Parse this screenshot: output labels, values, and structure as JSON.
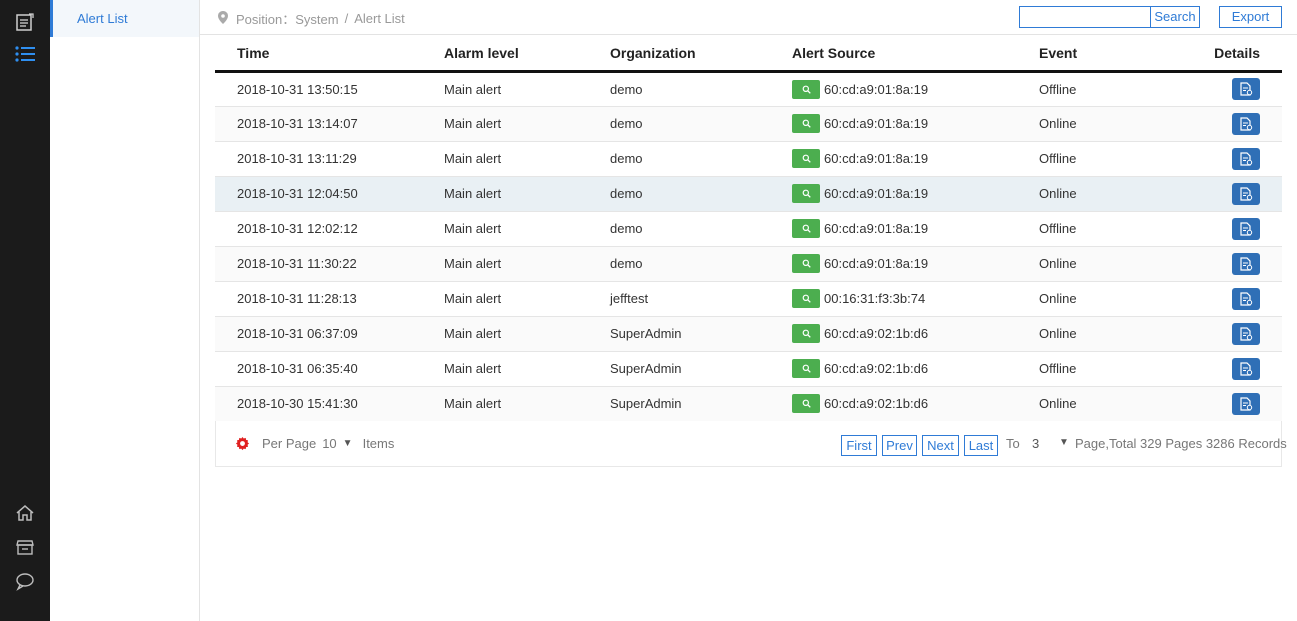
{
  "rail": {
    "icons": [
      "notebook-icon",
      "list-icon",
      "home-icon",
      "store-icon",
      "chat-icon"
    ]
  },
  "subnav": {
    "active_item": "Alert List"
  },
  "breadcrumb": {
    "prefix": "Position：System",
    "separator": "/",
    "current": "Alert List"
  },
  "search": {
    "value": "",
    "placeholder": "",
    "button_label": "Search"
  },
  "export_label": "Export",
  "colors": {
    "accent": "#2f7bd6",
    "rail_bg": "#1b1b1b",
    "query_green": "#4cae4f",
    "details_blue": "#2f6fb6"
  },
  "table": {
    "headers": {
      "time": "Time",
      "level": "Alarm level",
      "org": "Organization",
      "source": "Alert Source",
      "event": "Event",
      "details": "Details"
    },
    "rows": [
      {
        "time": "2018-10-31 13:50:15",
        "level": "Main alert",
        "org": "demo",
        "source": "60:cd:a9:01:8a:19",
        "event": "Offline"
      },
      {
        "time": "2018-10-31 13:14:07",
        "level": "Main alert",
        "org": "demo",
        "source": "60:cd:a9:01:8a:19",
        "event": "Online"
      },
      {
        "time": "2018-10-31 13:11:29",
        "level": "Main alert",
        "org": "demo",
        "source": "60:cd:a9:01:8a:19",
        "event": "Offline"
      },
      {
        "time": "2018-10-31 12:04:50",
        "level": "Main alert",
        "org": "demo",
        "source": "60:cd:a9:01:8a:19",
        "event": "Online"
      },
      {
        "time": "2018-10-31 12:02:12",
        "level": "Main alert",
        "org": "demo",
        "source": "60:cd:a9:01:8a:19",
        "event": "Offline"
      },
      {
        "time": "2018-10-31 11:30:22",
        "level": "Main alert",
        "org": "demo",
        "source": "60:cd:a9:01:8a:19",
        "event": "Online"
      },
      {
        "time": "2018-10-31 11:28:13",
        "level": "Main alert",
        "org": "jefftest",
        "source": "00:16:31:f3:3b:74",
        "event": "Online"
      },
      {
        "time": "2018-10-31 06:37:09",
        "level": "Main alert",
        "org": "SuperAdmin",
        "source": "60:cd:a9:02:1b:d6",
        "event": "Online"
      },
      {
        "time": "2018-10-31 06:35:40",
        "level": "Main alert",
        "org": "SuperAdmin",
        "source": "60:cd:a9:02:1b:d6",
        "event": "Offline"
      },
      {
        "time": "2018-10-30 15:41:30",
        "level": "Main alert",
        "org": "SuperAdmin",
        "source": "60:cd:a9:02:1b:d6",
        "event": "Online"
      }
    ]
  },
  "pager": {
    "per_page_label": "Per Page",
    "per_page_value": "10",
    "items_label": "Items",
    "first": "First",
    "prev": "Prev",
    "next": "Next",
    "last": "Last",
    "to_label": "To",
    "page_value": "3",
    "total_text": "Page,Total  329 Pages  3286 Records"
  }
}
